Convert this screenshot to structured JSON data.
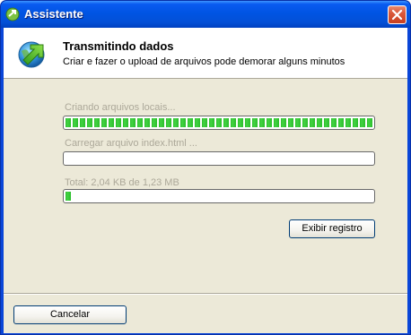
{
  "window": {
    "title": "Assistente",
    "colors": {
      "titlebar": "#0054e3",
      "close": "#d9583a",
      "progress_fill": "#2bbd2b",
      "dialog_bg": "#ece9d8"
    }
  },
  "header": {
    "title": "Transmitindo dados",
    "subtitle": "Criar e fazer o upload de arquivos pode demorar alguns minutos",
    "icon": "green-arrow-globe-icon"
  },
  "steps": [
    {
      "label": "Criando arquivos locais...",
      "progress": 1.0
    },
    {
      "label": "Carregar arquivo index.html ...",
      "progress": 0.0
    },
    {
      "label": "Total: 2,04 KB de 1,23 MB",
      "progress": 0.02
    }
  ],
  "buttons": {
    "show_log": "Exibir registro",
    "cancel": "Cancelar"
  }
}
